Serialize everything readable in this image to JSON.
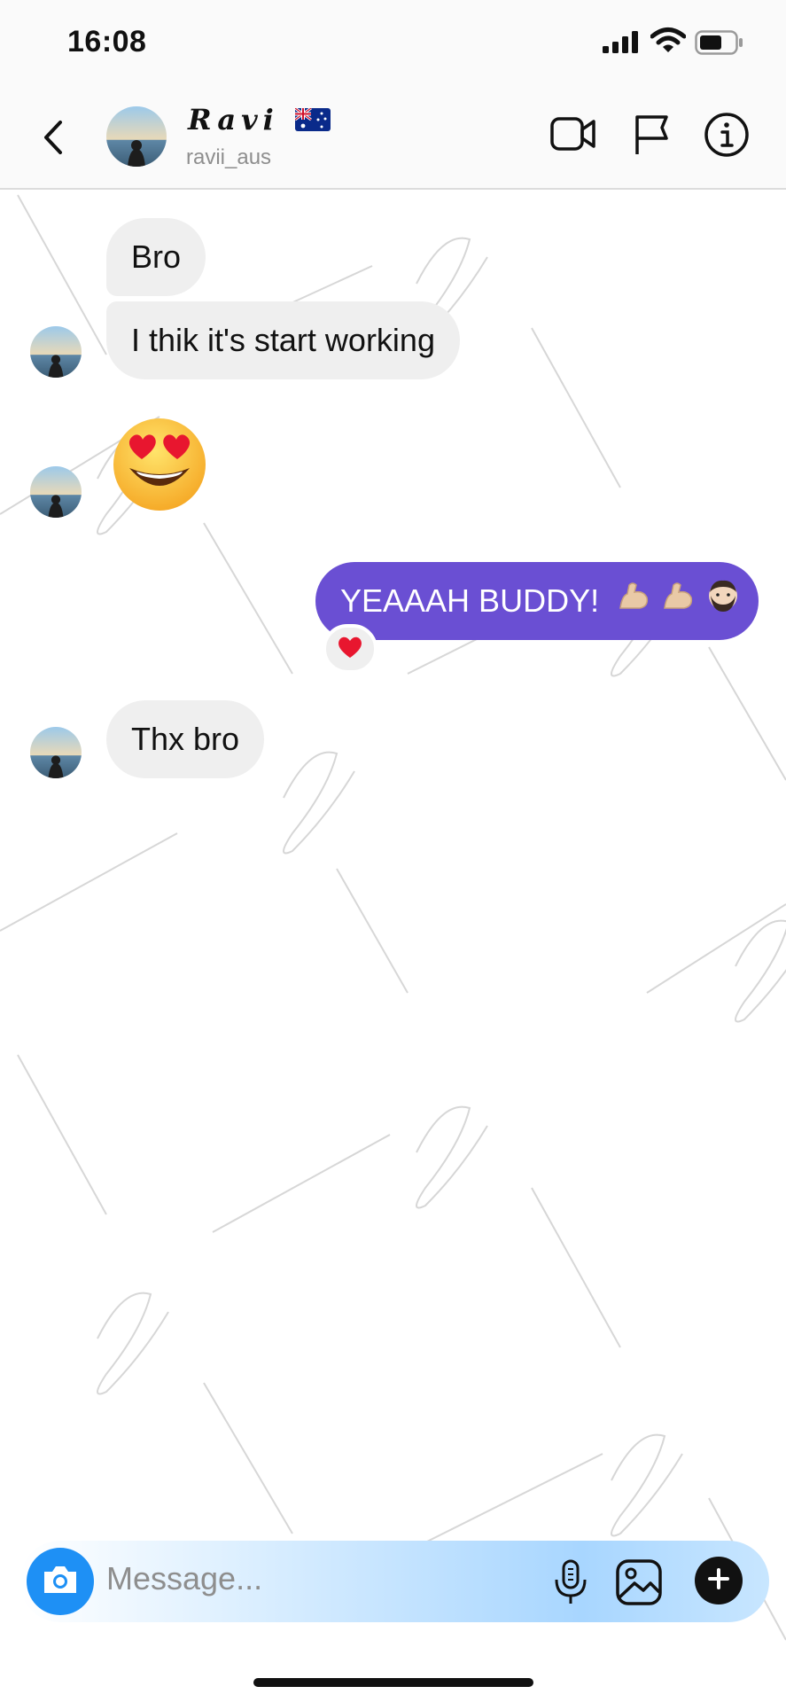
{
  "status_bar": {
    "time": "16:08",
    "signal_icon": "cellular-signal-icon",
    "wifi_icon": "wifi-icon",
    "battery_icon": "battery-icon"
  },
  "header": {
    "back_icon": "chevron-left-icon",
    "name": "Ravi",
    "name_flag_icon": "australia-flag-icon",
    "username": "ravii_aus",
    "video_icon": "video-camera-icon",
    "report_icon": "flag-icon",
    "info_icon": "info-icon"
  },
  "messages": [
    {
      "direction": "in",
      "text": "Bro"
    },
    {
      "direction": "in",
      "text": "I thik it's start working"
    },
    {
      "direction": "in",
      "emoji": "heart-eyes-emoji"
    },
    {
      "direction": "out",
      "text": "YEAAAH BUDDY!",
      "emoji": [
        "flexed-biceps-emoji",
        "flexed-biceps-emoji",
        "bearded-man-emoji"
      ],
      "reaction": "red-heart-emoji"
    },
    {
      "direction": "in",
      "text": "Thx bro"
    }
  ],
  "composer": {
    "camera_icon": "camera-icon",
    "placeholder": "Message...",
    "mic_icon": "microphone-icon",
    "gallery_icon": "image-gallery-icon",
    "plus_icon": "plus-icon"
  },
  "colors": {
    "outgoing_bubble": "#6a4fd3",
    "incoming_bubble": "#efefef",
    "camera_button": "#1e90f5"
  }
}
